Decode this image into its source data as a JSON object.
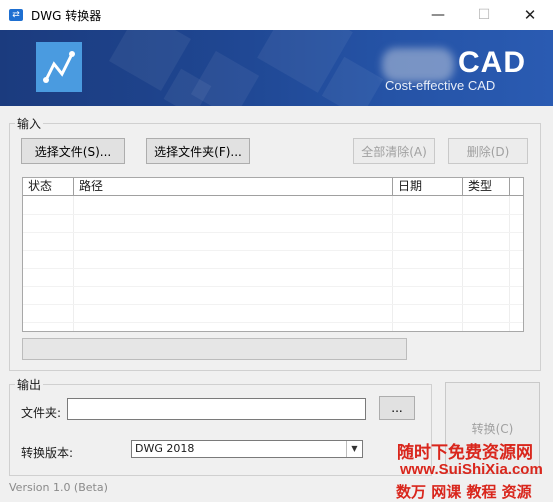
{
  "window": {
    "title": "DWG 转换器",
    "icon": "swap-icon",
    "minimize_glyph": "—",
    "maximize_glyph": "☐",
    "close_glyph": "✕"
  },
  "banner": {
    "brand": "CAD",
    "tagline": "Cost-effective CAD",
    "logo_icon": "cad-logo-icon"
  },
  "input_group": {
    "label": "输入",
    "select_files_label": "选择文件(S)...",
    "select_folder_label": "选择文件夹(F)...",
    "clear_all_label": "全部清除(A)",
    "delete_label": "删除(D)",
    "columns": [
      "状态",
      "路径",
      "日期",
      "类型"
    ],
    "rows": []
  },
  "output_group": {
    "label": "输出",
    "folder_label": "文件夹:",
    "folder_value": "",
    "browse_label": "...",
    "version_label": "转换版本:",
    "version_value": "DWG 2018"
  },
  "convert_label": "转换(C)",
  "version_text": "Version 1.0 (Beta)",
  "watermark": {
    "line1": "随时下免费资源网",
    "line2": "www.SuiShiXia.com",
    "line3": "数万 网课 教程 资源"
  },
  "colors": {
    "banner": "#1f4691",
    "watermark": "#d9261c",
    "disabled_text": "#a0a0a0"
  }
}
